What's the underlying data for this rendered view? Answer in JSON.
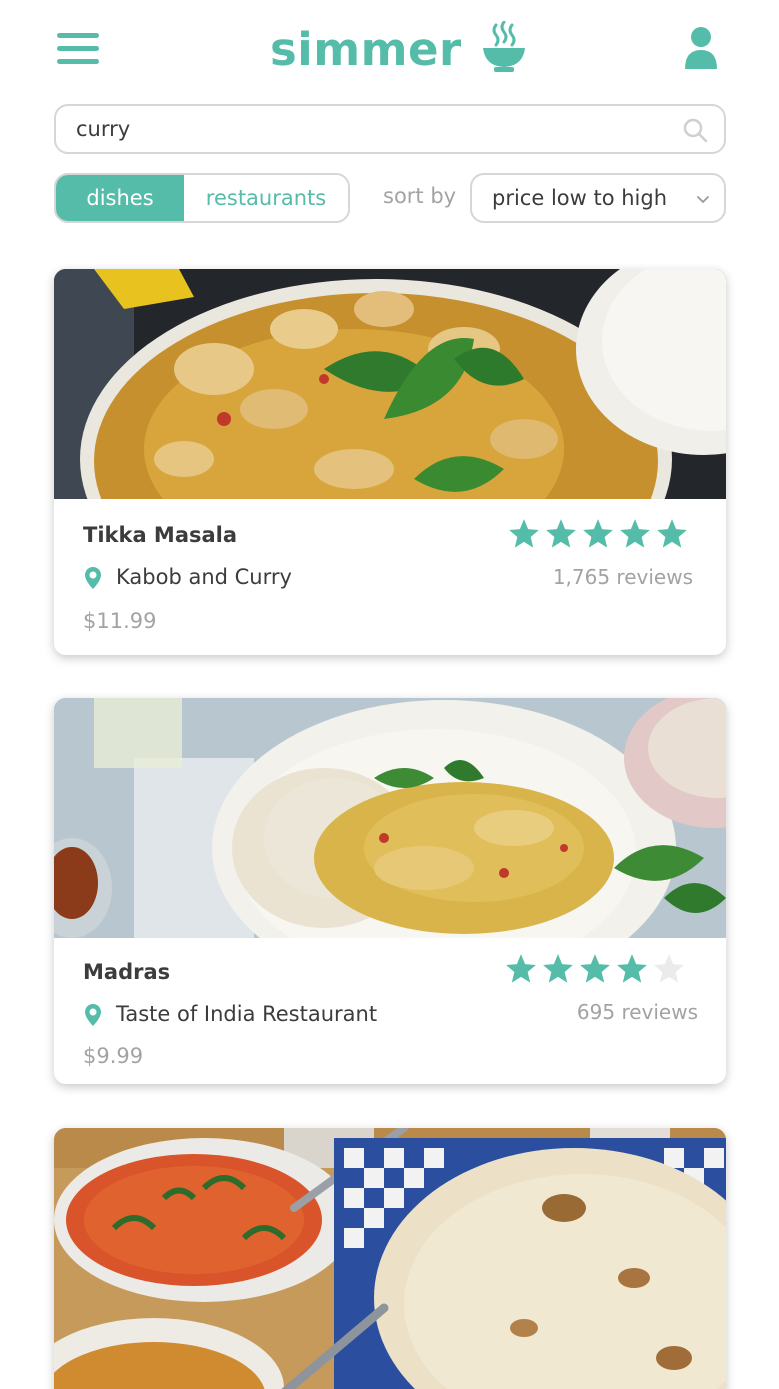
{
  "app": {
    "name": "simmer"
  },
  "colors": {
    "accent": "#56bcaa",
    "star_on": "#56bcaa",
    "star_off": "#ebebeb",
    "muted": "#a3a3a3",
    "text": "#3c3c3c"
  },
  "icons": {
    "menu": "hamburger-menu-icon",
    "logo": "steaming-bowl-icon",
    "user": "user-icon",
    "search": "search-icon",
    "location": "location-pin-icon",
    "sort": "chevron-down-icon"
  },
  "search": {
    "value": "curry"
  },
  "tabs": [
    {
      "label": "dishes",
      "active": true
    },
    {
      "label": "restaurants",
      "active": false
    }
  ],
  "sort": {
    "label": "sort by",
    "selected": "price low to high"
  },
  "results": [
    {
      "dish": "Tikka Masala",
      "restaurant": "Kabob and Curry",
      "price": "$11.99",
      "rating": 5,
      "reviews": "1,765 reviews",
      "image": "tikka-masala-photo"
    },
    {
      "dish": "Madras",
      "restaurant": "Taste of India Restaurant",
      "price": "$9.99",
      "rating": 4,
      "reviews": "695 reviews",
      "image": "madras-photo"
    },
    {
      "image": "curry-and-naan-photo"
    }
  ]
}
